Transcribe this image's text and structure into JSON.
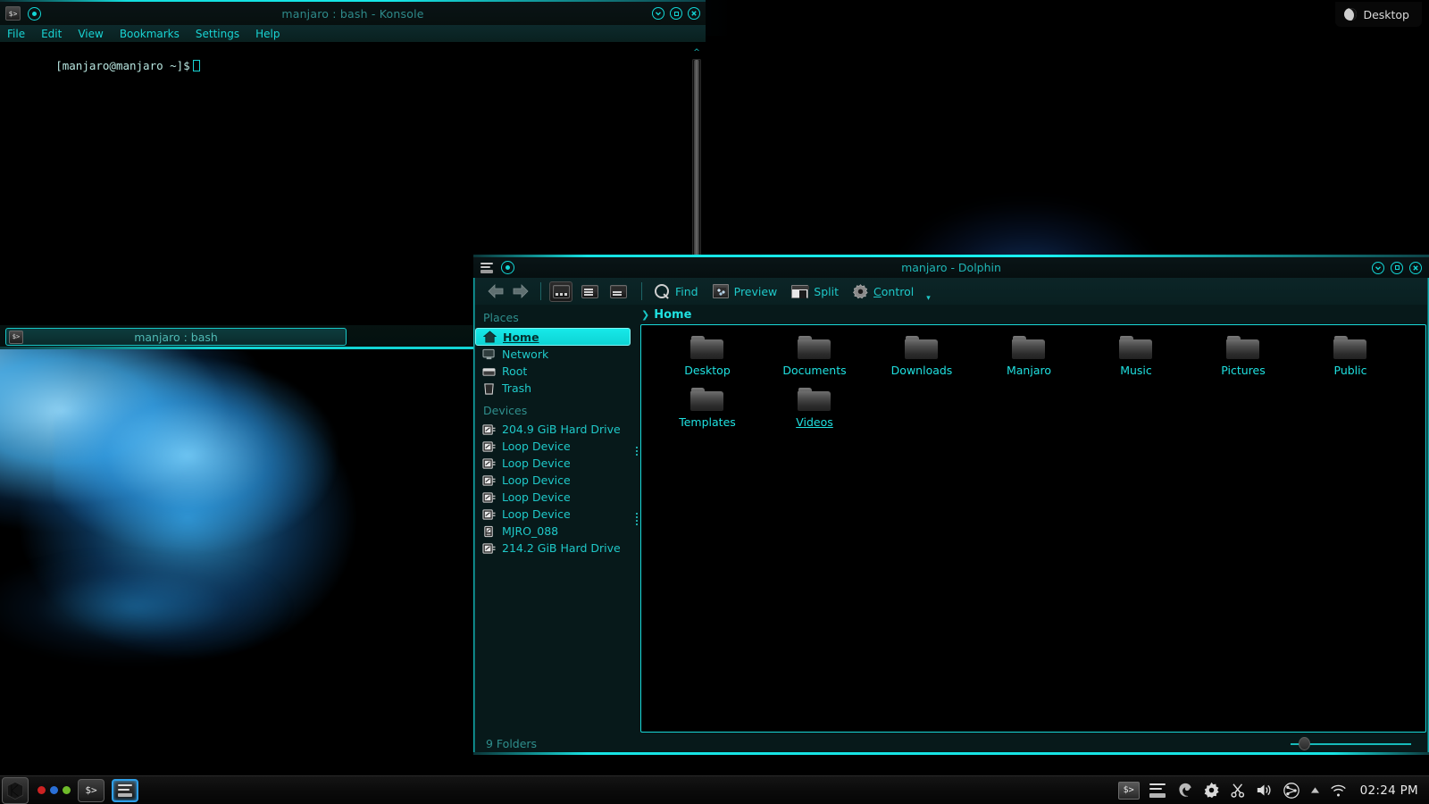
{
  "desktop": {
    "widget_label": "Desktop",
    "widget_icon": "moon-icon"
  },
  "konsole": {
    "title": "manjaro : bash - Konsole",
    "menu": [
      "File",
      "Edit",
      "View",
      "Bookmarks",
      "Settings",
      "Help"
    ],
    "prompt": "[manjaro@manjaro ~]$",
    "tab_label": "manjaro : bash",
    "window_buttons": [
      "minimize-icon",
      "maximize-icon",
      "close-icon"
    ]
  },
  "dolphin": {
    "title": "manjaro - Dolphin",
    "window_buttons": [
      "minimize-icon",
      "maximize-icon",
      "close-icon"
    ],
    "toolbar": {
      "back": "back-arrow-icon",
      "forward": "forward-arrow-icon",
      "view_modes": [
        "icons-view-icon",
        "compact-view-icon",
        "details-view-icon"
      ],
      "active_view_mode": 0,
      "find_label": "Find",
      "preview_label": "Preview",
      "split_label": "Split",
      "control_label": "Control"
    },
    "places": {
      "section_places": "Places",
      "items": [
        {
          "label": "Home",
          "icon": "home-icon",
          "selected": true
        },
        {
          "label": "Network",
          "icon": "network-icon",
          "selected": false
        },
        {
          "label": "Root",
          "icon": "root-folder-icon",
          "selected": false
        },
        {
          "label": "Trash",
          "icon": "trash-icon",
          "selected": false
        }
      ],
      "section_devices": "Devices",
      "devices": [
        {
          "label": "204.9 GiB Hard Drive",
          "icon": "hard-drive-icon"
        },
        {
          "label": "Loop Device",
          "icon": "hard-drive-icon"
        },
        {
          "label": "Loop Device",
          "icon": "hard-drive-icon"
        },
        {
          "label": "Loop Device",
          "icon": "hard-drive-icon"
        },
        {
          "label": "Loop Device",
          "icon": "hard-drive-icon"
        },
        {
          "label": "Loop Device",
          "icon": "hard-drive-icon"
        },
        {
          "label": "MJRO_088",
          "icon": "usb-drive-icon"
        },
        {
          "label": "214.2 GiB Hard Drive",
          "icon": "hard-drive-icon"
        }
      ]
    },
    "breadcrumb": "Home",
    "files": [
      {
        "name": "Desktop",
        "icon": "folder-icon",
        "hovered": false
      },
      {
        "name": "Documents",
        "icon": "folder-icon",
        "hovered": false
      },
      {
        "name": "Downloads",
        "icon": "folder-icon",
        "hovered": false
      },
      {
        "name": "Manjaro",
        "icon": "folder-icon",
        "hovered": false
      },
      {
        "name": "Music",
        "icon": "folder-icon",
        "hovered": false
      },
      {
        "name": "Pictures",
        "icon": "folder-icon",
        "hovered": false
      },
      {
        "name": "Public",
        "icon": "folder-icon",
        "hovered": false
      },
      {
        "name": "Templates",
        "icon": "folder-icon",
        "hovered": false
      },
      {
        "name": "Videos",
        "icon": "folder-icon",
        "hovered": true
      }
    ],
    "status": "9 Folders"
  },
  "taskbar": {
    "launcher_icon": "kde-logo-icon",
    "pager_dots": [
      "#cc2222",
      "#2a6fd6",
      "#6fbb2a"
    ],
    "tasks": [
      {
        "icon": "terminal-icon",
        "active": false
      },
      {
        "icon": "file-manager-icon",
        "active": true
      }
    ],
    "tray": [
      {
        "icon": "terminal-icon"
      },
      {
        "icon": "file-manager-icon"
      },
      {
        "icon": "firefox-icon"
      },
      {
        "icon": "settings-gear-icon"
      },
      {
        "icon": "clipboard-scissors-icon"
      },
      {
        "icon": "volume-icon"
      },
      {
        "icon": "network-share-icon"
      },
      {
        "icon": "show-hidden-arrow-icon"
      },
      {
        "icon": "wifi-icon"
      }
    ],
    "clock": "02:24 PM"
  },
  "theme": {
    "accent": "#17d9d9",
    "accent_bright": "#1fe0e0",
    "panel_bg": "#07191a",
    "title_bg": "#0a1517",
    "muted_text": "#2f8f8d"
  }
}
